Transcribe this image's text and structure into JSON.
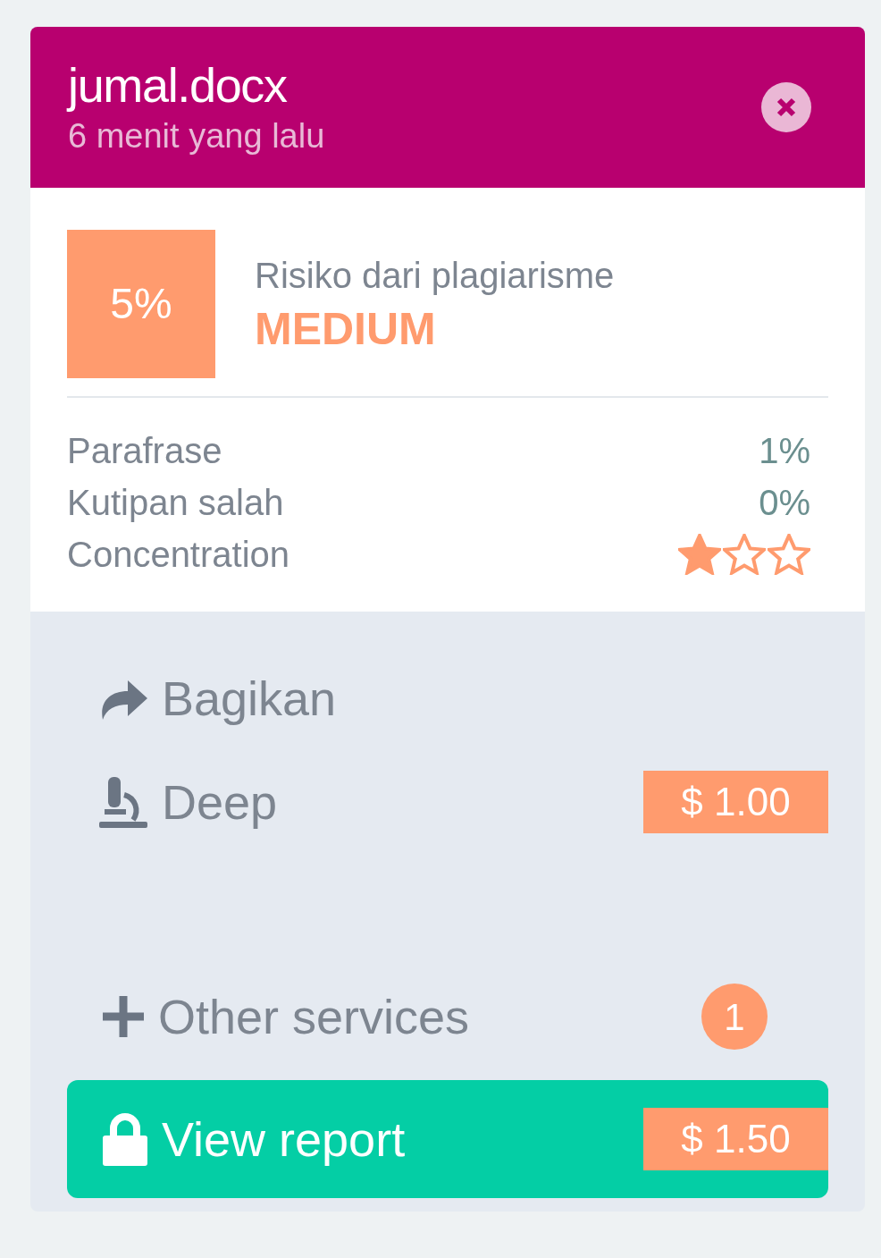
{
  "file": {
    "name": "jumal.docx",
    "time": "6 menit yang lalu"
  },
  "risk": {
    "percent": "5%",
    "label": "Risiko dari plagiarisme",
    "level": "MEDIUM"
  },
  "metrics": [
    {
      "kind": "percent",
      "label": "Parafrase",
      "value": "1%"
    },
    {
      "kind": "percent",
      "label": "Kutipan salah",
      "value": "0%"
    },
    {
      "kind": "stars",
      "label": "Concentration",
      "stars": 1
    }
  ],
  "actions": [
    {
      "kind": "share",
      "label": "Bagikan"
    },
    {
      "kind": "deep",
      "label": "Deep",
      "price": "$ 1.00"
    }
  ],
  "other_services": {
    "label": "Other services",
    "count": "1"
  },
  "view_report": {
    "label": "View report",
    "price": "$ 1.50"
  }
}
